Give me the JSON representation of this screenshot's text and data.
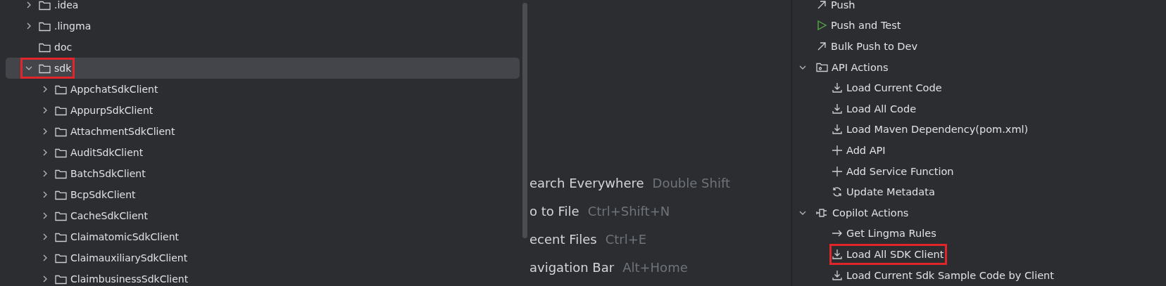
{
  "project_tree": {
    "items": [
      {
        "label": ".idea",
        "expanded": false,
        "selected": false,
        "annotated": false
      },
      {
        "label": ".lingma",
        "expanded": false,
        "selected": false,
        "annotated": false
      },
      {
        "label": "doc",
        "selected": false,
        "annotated": false
      },
      {
        "label": "sdk",
        "expanded": true,
        "selected": true,
        "annotated": true,
        "children": [
          {
            "label": "AppchatSdkClient",
            "expanded": false,
            "selected": false,
            "annotated": false
          },
          {
            "label": "AppurpSdkClient",
            "expanded": false,
            "selected": false,
            "annotated": false
          },
          {
            "label": "AttachmentSdkClient",
            "expanded": false,
            "selected": false,
            "annotated": false
          },
          {
            "label": "AuditSdkClient",
            "expanded": false,
            "selected": false,
            "annotated": false
          },
          {
            "label": "BatchSdkClient",
            "expanded": false,
            "selected": false,
            "annotated": false
          },
          {
            "label": "BcpSdkClient",
            "expanded": false,
            "selected": false,
            "annotated": false
          },
          {
            "label": "CacheSdkClient",
            "expanded": false,
            "selected": false,
            "annotated": false
          },
          {
            "label": "ClaimatomicSdkClient",
            "expanded": false,
            "selected": false,
            "annotated": false
          },
          {
            "label": "ClaimauxiliarySdkClient",
            "expanded": false,
            "selected": false,
            "annotated": false
          },
          {
            "label": "ClaimbusinessSdkClient",
            "expanded": false,
            "selected": false,
            "annotated": false
          }
        ]
      }
    ]
  },
  "editor_hints": [
    {
      "action": "earch Everywhere",
      "shortcut": "Double Shift"
    },
    {
      "action": "o to File",
      "shortcut": "Ctrl+Shift+N"
    },
    {
      "action": "ecent Files",
      "shortcut": "Ctrl+E"
    },
    {
      "action": "avigation Bar",
      "shortcut": "Alt+Home"
    }
  ],
  "actions_tree": {
    "items": [
      {
        "kind": "push",
        "label": "Push",
        "annotated": false
      },
      {
        "kind": "run",
        "label": "Push and Test",
        "annotated": false
      },
      {
        "kind": "push",
        "label": "Bulk Push to Dev",
        "annotated": false
      },
      {
        "kind": "group",
        "label": "API Actions",
        "expanded": true,
        "annotated": false,
        "children": [
          {
            "kind": "download",
            "label": "Load Current Code",
            "annotated": false
          },
          {
            "kind": "download",
            "label": "Load All Code",
            "annotated": false
          },
          {
            "kind": "download",
            "label": "Load Maven Dependency(pom.xml)",
            "annotated": false
          },
          {
            "kind": "add",
            "label": "Add API",
            "annotated": false
          },
          {
            "kind": "add",
            "label": "Add Service Function",
            "annotated": false
          },
          {
            "kind": "sync",
            "label": "Update Metadata",
            "annotated": false
          }
        ]
      },
      {
        "kind": "plugin",
        "label": "Copilot Actions",
        "expanded": true,
        "annotated": false,
        "children": [
          {
            "kind": "arrow",
            "label": "Get Lingma Rules",
            "annotated": false
          },
          {
            "kind": "download",
            "label": "Load All SDK Client",
            "annotated": true
          },
          {
            "kind": "download",
            "label": "Load Current Sdk Sample Code by Client",
            "annotated": false
          }
        ]
      }
    ]
  }
}
